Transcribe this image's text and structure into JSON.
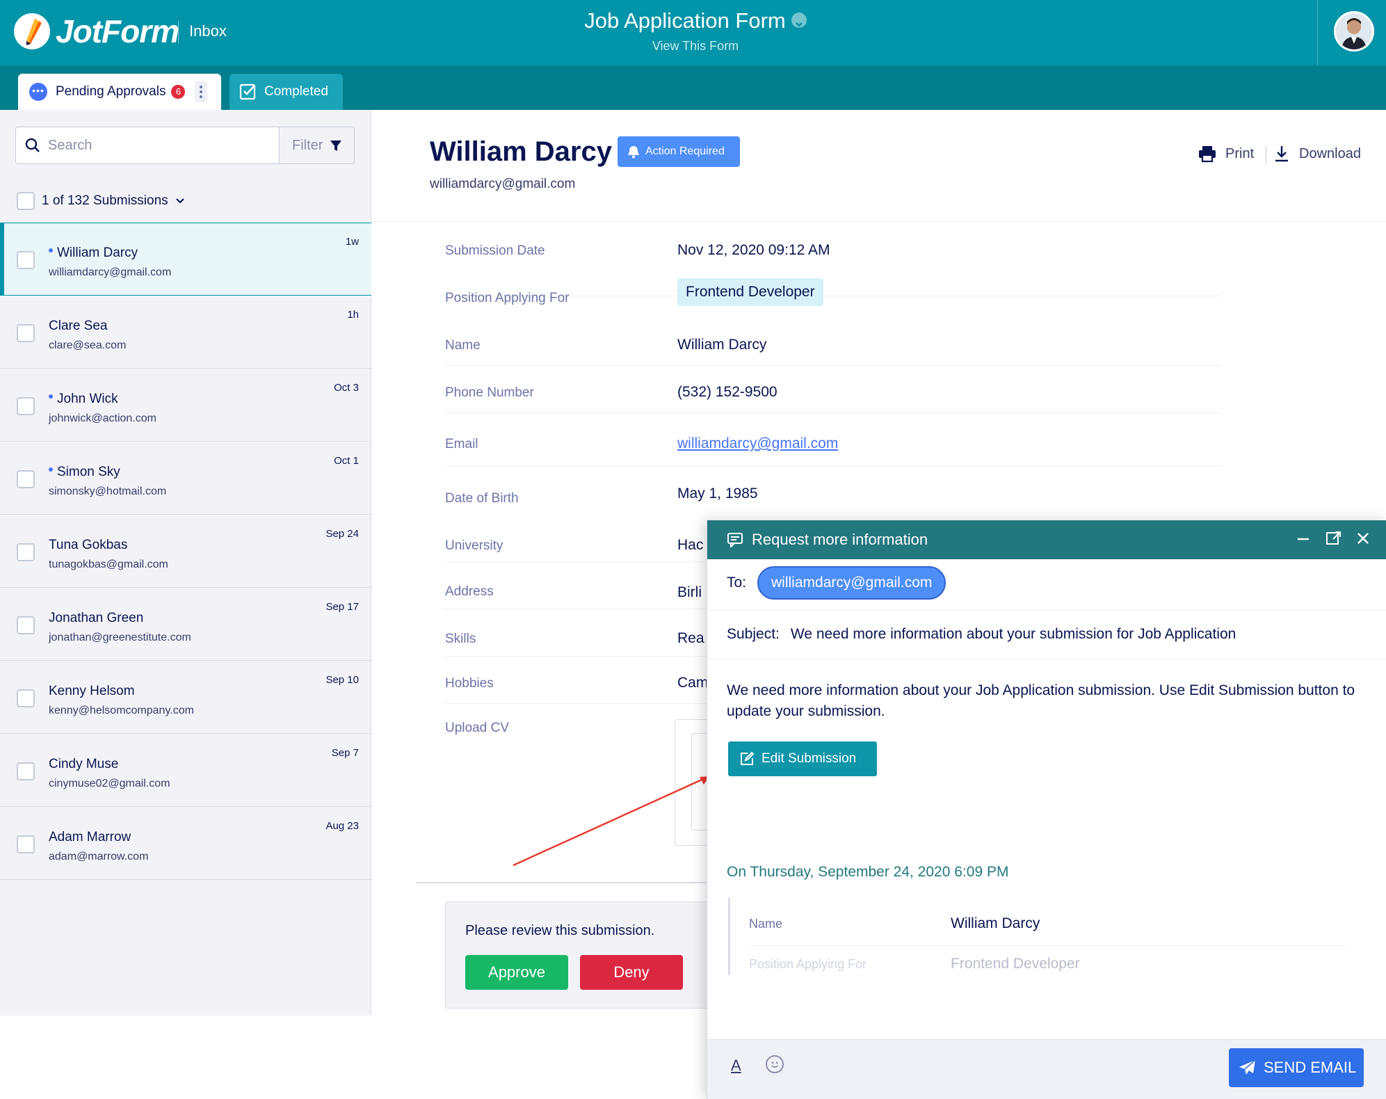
{
  "header": {
    "brand": "JotForm",
    "section": "Inbox",
    "form_title": "Job Application Form",
    "view_form": "View This Form"
  },
  "tabs": {
    "pending": {
      "label": "Pending Approvals",
      "count": "6"
    },
    "completed": {
      "label": "Completed"
    }
  },
  "sidebar": {
    "search_placeholder": "Search",
    "filter_label": "Filter",
    "submissions_label": "1 of 132 Submissions",
    "items": [
      {
        "name": "William Darcy",
        "email": "williamdarcy@gmail.com",
        "time": "1w",
        "unread": true
      },
      {
        "name": "Clare Sea",
        "email": "clare@sea.com",
        "time": "1h",
        "unread": false
      },
      {
        "name": "John Wick",
        "email": "johnwick@action.com",
        "time": "Oct 3",
        "unread": true
      },
      {
        "name": "Simon Sky",
        "email": "simonsky@hotmail.com",
        "time": "Oct 1",
        "unread": true
      },
      {
        "name": "Tuna Gokbas",
        "email": "tunagokbas@gmail.com",
        "time": "Sep 24",
        "unread": false
      },
      {
        "name": "Jonathan Green",
        "email": "jonathan@greenestitute.com",
        "time": "Sep 17",
        "unread": false
      },
      {
        "name": "Kenny Helsom",
        "email": "kenny@helsomcompany.com",
        "time": "Sep 10",
        "unread": false
      },
      {
        "name": "Cindy Muse",
        "email": "cinymuse02@gmail.com",
        "time": "Sep 7",
        "unread": false
      },
      {
        "name": "Adam Marrow",
        "email": "adam@marrow.com",
        "time": "Aug 23",
        "unread": false
      }
    ]
  },
  "submission": {
    "name": "William Darcy",
    "email": "williamdarcy@gmail.com",
    "status": "Action Required",
    "print_label": "Print",
    "download_label": "Download",
    "fields": [
      {
        "label": "Submission Date",
        "value": "Nov 12, 2020 09:12 AM"
      },
      {
        "label": "Position Applying For",
        "value": "Frontend Developer"
      },
      {
        "label": "Name",
        "value": "William Darcy"
      },
      {
        "label": "Phone Number",
        "value": "(532) 152-9500"
      },
      {
        "label": "Email",
        "value": "williamdarcy@gmail.com"
      },
      {
        "label": "Date of Birth",
        "value": "May 1, 1985"
      },
      {
        "label": "University",
        "value": "Hac"
      },
      {
        "label": "Address",
        "value": "Birli"
      },
      {
        "label": "Skills",
        "value": "Rea"
      },
      {
        "label": "Hobbies",
        "value": "Cam"
      },
      {
        "label": "Upload CV",
        "value": ""
      }
    ],
    "review_text": "Please review this submission.",
    "approve_label": "Approve",
    "deny_label": "Deny"
  },
  "modal": {
    "title": "Request more information",
    "to_label": "To:",
    "to_value": "williamdarcy@gmail.com",
    "subject_label": "Subject:",
    "subject_value": "We need more information about your submission for Job Application",
    "body": "We need more information about your Job Application submission. Use Edit Submission button to update your submission.",
    "edit_button": "Edit Submission",
    "quote_date": "On Thursday, September 24, 2020 6:09 PM",
    "quote_fields": [
      {
        "label": "Name",
        "value": "William Darcy"
      },
      {
        "label": "Position Applying For",
        "value": "Frontend Developer"
      }
    ],
    "format_label": "A",
    "send_label": "SEND EMAIL"
  },
  "colors": {
    "header": "#0294a8",
    "tabs_bar": "#027f8d",
    "modal_header": "#23787f",
    "approve": "#18b766",
    "deny": "#dc2741",
    "send": "#2f6fe8",
    "accent_blue": "#4d8ef8"
  }
}
